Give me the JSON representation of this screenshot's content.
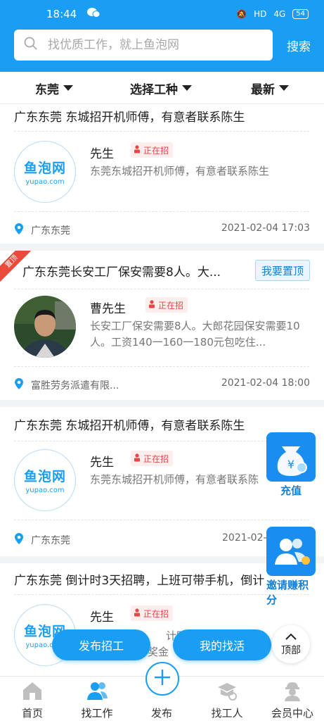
{
  "status_bar": {
    "time": "18:44",
    "signal": "HD",
    "network": "4G",
    "battery": "54"
  },
  "search": {
    "placeholder": "找优质工作，就上鱼泡网",
    "button": "搜索"
  },
  "filters": [
    "东莞",
    "选择工种",
    "最新"
  ],
  "cards": [
    {
      "title": "广东东莞 东城招开机师傅，有意者联系陈生",
      "logo_main": "鱼泡网",
      "logo_sub": "yupao.com",
      "poster": "先生",
      "status": "正在招",
      "description": "东莞东城招开机师傅，有意者联系陈生",
      "location": "广东东莞",
      "date": "2021-02-04 17:03"
    },
    {
      "corner": "置顶",
      "title": "广东东莞长安工厂保安需要8人。大...",
      "top_button": "我要置顶",
      "poster": "曹先生",
      "status": "正在招",
      "description": "长安工厂保安需要8人。大郎花园保安需要10人。工资140一160一180元包吃住...",
      "location": "富胜劳务派遣有限...",
      "date": "2021-02-04 18:00"
    },
    {
      "title": "广东东莞 东城招开机师傅，有意者联系陈生",
      "logo_main": "鱼泡网",
      "logo_sub": "yupao.com",
      "poster": "先生",
      "status": "正在招",
      "description": "东莞东城招开机师傅，有意者联系陈",
      "location": "广东东莞",
      "date": "2021-02-"
    },
    {
      "title": "广东东莞 倒计时3天招聘，上班可带手机，倒计",
      "logo_main": "鱼泡网",
      "logo_sub": "yupao.com",
      "poster": "先生",
      "status": "正在招",
      "description_frag1": "计时3",
      "description_frag2": "奖金"
    }
  ],
  "float_side": {
    "recharge": "充值",
    "invite": "邀请赚积分"
  },
  "float_buttons": {
    "post_job": "发布招工",
    "my_jobs": "我的找活",
    "top": "顶部"
  },
  "bottom_nav": [
    "首页",
    "找工作",
    "发布",
    "找工人",
    "会员中心"
  ],
  "colors": {
    "brand_blue": "#1a9ef3",
    "badge_red": "#e84545"
  }
}
